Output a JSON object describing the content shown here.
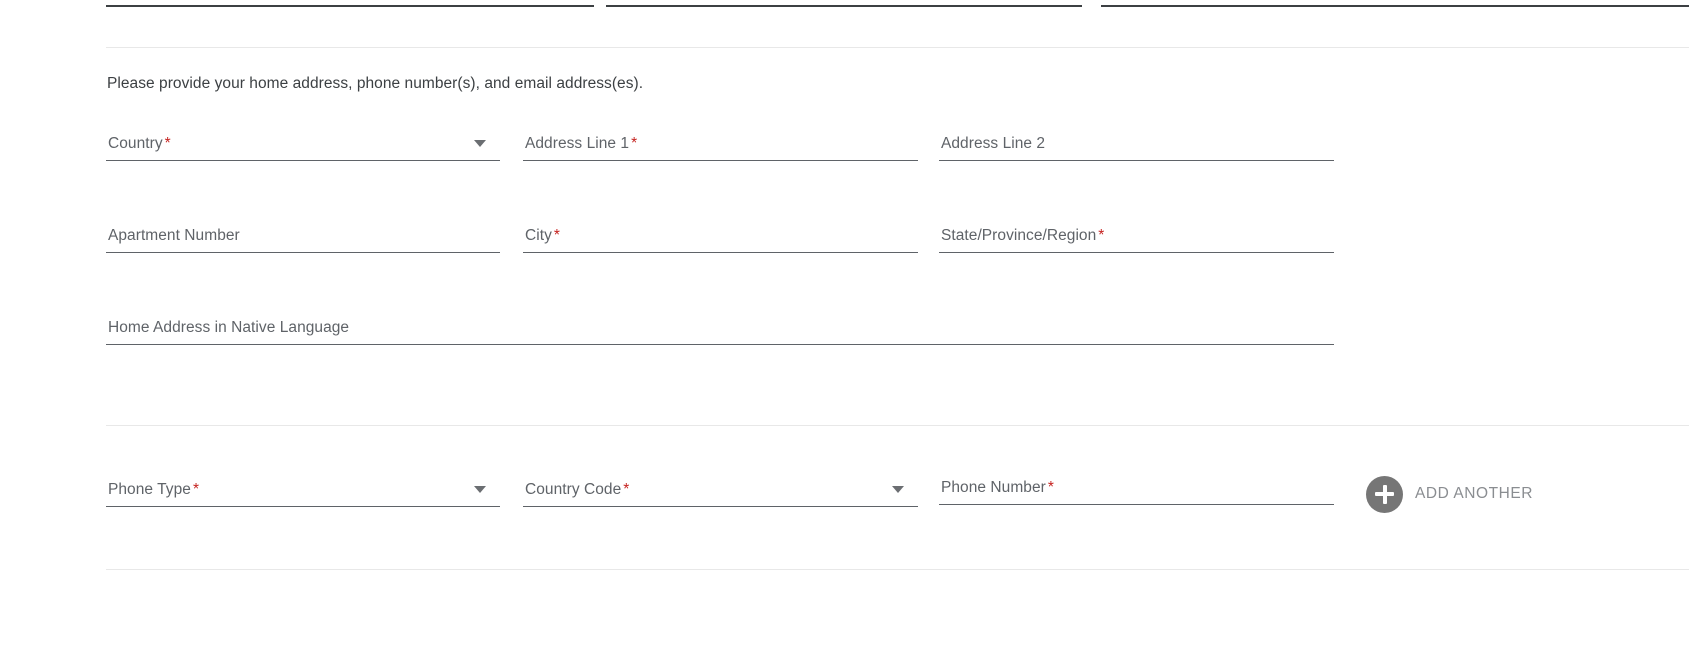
{
  "section": {
    "instruction": "Please provide your home address, phone number(s), and email address(es)."
  },
  "required_marker": "*",
  "colors": {
    "required_asterisk": "#c5221f",
    "label_text": "#5f6368",
    "body_text": "#3c4043",
    "field_underline": "#5f6368",
    "divider": "#e8e8e8",
    "add_button_circle": "#767676",
    "add_button_label": "#8a8d91"
  },
  "address_fields": {
    "country": {
      "label": "Country",
      "value": "",
      "placeholder": "Country",
      "required": true,
      "type": "select"
    },
    "address_line_1": {
      "label": "Address Line 1",
      "value": "",
      "placeholder": "Address Line 1",
      "required": true,
      "type": "text"
    },
    "address_line_2": {
      "label": "Address Line 2",
      "value": "",
      "placeholder": "Address Line 2",
      "required": false,
      "type": "text"
    },
    "apartment_number": {
      "label": "Apartment Number",
      "value": "",
      "placeholder": "Apartment Number",
      "required": false,
      "type": "text"
    },
    "city": {
      "label": "City",
      "value": "",
      "placeholder": "City",
      "required": true,
      "type": "text"
    },
    "state_province_region": {
      "label": "State/Province/Region",
      "value": "",
      "placeholder": "State/Province/Region",
      "required": true,
      "type": "text"
    },
    "native_address": {
      "label": "Home Address in Native Language",
      "value": "",
      "placeholder": "Home Address in Native Language",
      "required": false,
      "type": "text"
    }
  },
  "phone_fields": {
    "phone_type": {
      "label": "Phone Type",
      "value": "",
      "placeholder": "Phone Type",
      "required": true,
      "type": "select"
    },
    "country_code": {
      "label": "Country Code",
      "value": "",
      "placeholder": "Country Code",
      "required": true,
      "type": "select"
    },
    "phone_number": {
      "label": "Phone Number",
      "value": "",
      "placeholder": "Phone Number",
      "required": true,
      "type": "text"
    }
  },
  "add_another": {
    "label": "ADD ANOTHER",
    "icon": "plus-circle-icon"
  },
  "icons": {
    "dropdown": "chevron-down-icon"
  }
}
